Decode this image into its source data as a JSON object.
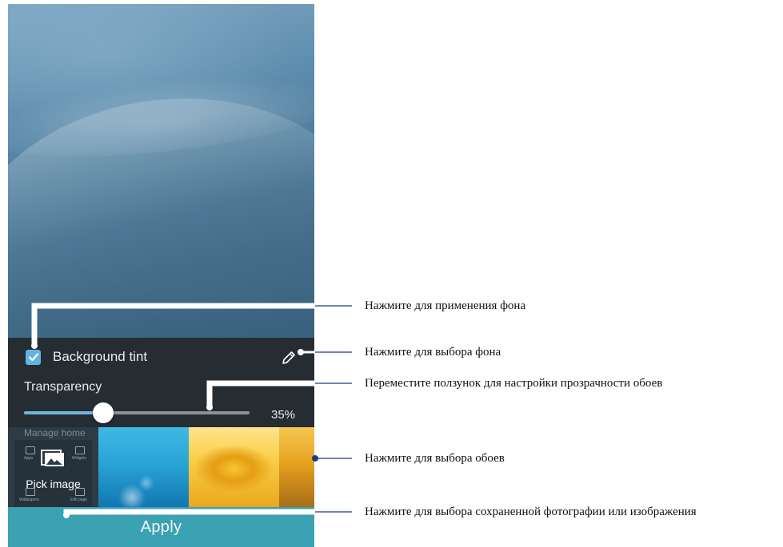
{
  "screen": {
    "background_tint": {
      "label": "Background tint",
      "checked": true
    },
    "transparency": {
      "label": "Transparency",
      "value_text": "35%",
      "value": 0.35
    },
    "wallpaper_strip": {
      "manage_home_label": "Manage home",
      "pick_image_label": "Pick image",
      "mini_labels": [
        "Apps",
        "Widgets",
        "Wallpapers",
        "Edit page"
      ]
    },
    "apply_label": "Apply"
  },
  "callouts": [
    {
      "text": "Нажмите для применения фона"
    },
    {
      "text": "Нажмите для выбора фона"
    },
    {
      "text": "Переместите ползунок для настройки прозрачности обоев"
    },
    {
      "text": "Нажмите для выбора обоев"
    },
    {
      "text": "Нажмите для выбора сохраненной фотографии или изображения"
    }
  ],
  "colors": {
    "accent_blue": "#62b4e2",
    "apply_teal": "#3aa2b3",
    "callout_line": "#1a3d7a",
    "panel_dark": "#252d33"
  },
  "icons": {
    "checkbox": "check-icon",
    "edit": "pencil-icon",
    "pick": "image-gallery-icon"
  }
}
